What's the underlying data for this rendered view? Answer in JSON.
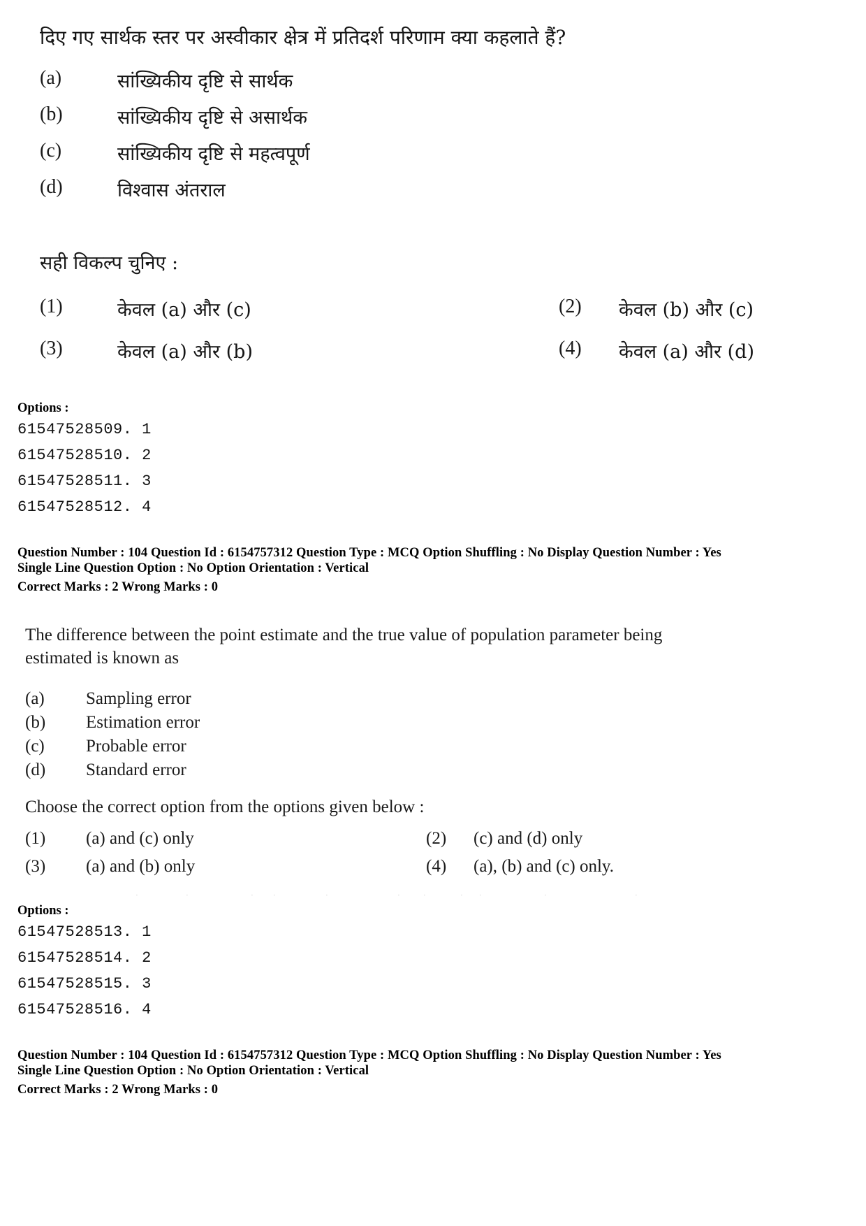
{
  "question_hi": {
    "stem": "दिए गए सार्थक स्तर पर अस्वीकार क्षेत्र में प्रतिदर्श परिणाम क्या कहलाते हैं?",
    "statements": [
      {
        "label": "(a)",
        "text": "सांख्यिकीय दृष्टि से सार्थक"
      },
      {
        "label": "(b)",
        "text": "सांख्यिकीय दृष्टि से असार्थक"
      },
      {
        "label": "(c)",
        "text": "सांख्यिकीय दृष्टि से महत्वपूर्ण"
      },
      {
        "label": "(d)",
        "text": "विश्वास अंतराल"
      }
    ],
    "instruction": "सही विकल्प चुनिए :",
    "choices": [
      {
        "label": "(1)",
        "text": "केवल (a) और (c)"
      },
      {
        "label": "(2)",
        "text": "केवल (b) और (c)"
      },
      {
        "label": "(3)",
        "text": "केवल (a) और (b)"
      },
      {
        "label": "(4)",
        "text": "केवल (a) और (d)"
      }
    ]
  },
  "options_block_1": {
    "heading": "Options :",
    "items": [
      "61547528509. 1",
      "61547528510. 2",
      "61547528511. 3",
      "61547528512. 4"
    ]
  },
  "meta_1": {
    "line1": "Question Number : 104  Question Id : 6154757312  Question Type : MCQ  Option Shuffling : No  Display Question Number : Yes",
    "line2": "Single Line Question Option : No  Option Orientation : Vertical",
    "line3": "Correct Marks : 2  Wrong Marks : 0"
  },
  "question_en": {
    "stem_line1": "The difference between the point estimate and the true value of population parameter being",
    "stem_line2": "estimated is known as",
    "statements": [
      {
        "label": "(a)",
        "text": "Sampling error"
      },
      {
        "label": "(b)",
        "text": "Estimation error"
      },
      {
        "label": "(c)",
        "text": "Probable error"
      },
      {
        "label": "(d)",
        "text": "Standard error"
      }
    ],
    "instruction": "Choose the correct option from the options given below :",
    "choices": [
      {
        "label": "(1)",
        "text": "(a) and (c) only"
      },
      {
        "label": "(2)",
        "text": "(c) and (d) only"
      },
      {
        "label": "(3)",
        "text": "(a) and (b) only"
      },
      {
        "label": "(4)",
        "text": "(a), (b) and (c) only."
      }
    ]
  },
  "options_block_2": {
    "heading": "Options :",
    "items": [
      "61547528513. 1",
      "61547528514. 2",
      "61547528515. 3",
      "61547528516. 4"
    ]
  },
  "meta_2": {
    "line1": "Question Number : 104  Question Id : 6154757312  Question Type : MCQ  Option Shuffling : No  Display Question Number : Yes",
    "line2": "Single Line Question Option : No  Option Orientation : Vertical",
    "line3": "Correct Marks : 2  Wrong Marks : 0"
  }
}
